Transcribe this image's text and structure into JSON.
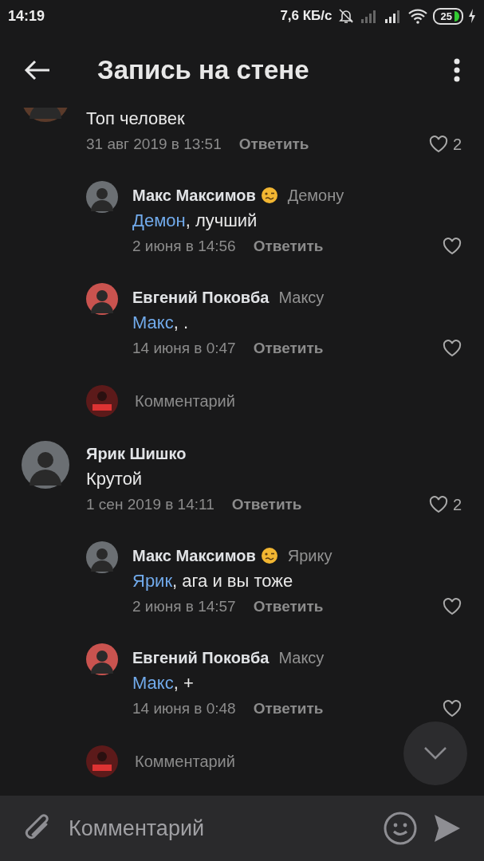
{
  "status_bar": {
    "time": "14:19",
    "speed": "7,6 КБ/с",
    "battery": "25"
  },
  "header": {
    "title": "Запись на стене"
  },
  "threads": [
    {
      "comment": {
        "text": "Топ человек",
        "date": "31 авг 2019 в 13:51",
        "reply": "Ответить",
        "likes": "2"
      },
      "replies": [
        {
          "author": "Макс Максимов",
          "emoji": true,
          "reply_to": "Демону",
          "mention": "Демон",
          "text": ", лучший",
          "date": "2 июня в 14:56",
          "reply": "Ответить"
        },
        {
          "author": "Евгений Поковба",
          "emoji": false,
          "reply_to": "Максу",
          "mention": "Макс",
          "text": ", .",
          "date": "14 июня в 0:47",
          "reply": "Ответить"
        }
      ],
      "composer": {
        "placeholder": "Комментарий"
      }
    },
    {
      "comment": {
        "author": "Ярик Шишко",
        "text": "Крутой",
        "date": "1 сен 2019 в 14:11",
        "reply": "Ответить",
        "likes": "2"
      },
      "replies": [
        {
          "author": "Макс Максимов",
          "emoji": true,
          "reply_to": "Ярику",
          "mention": "Ярик",
          "text": ", ага и вы тоже",
          "date": "2 июня в 14:57",
          "reply": "Ответить"
        },
        {
          "author": "Евгений Поковба",
          "emoji": false,
          "reply_to": "Максу",
          "mention": "Макс",
          "text": ", +",
          "date": "14 июня в 0:48",
          "reply": "Ответить"
        }
      ],
      "composer": {
        "placeholder": "Комментарий"
      }
    }
  ],
  "input": {
    "placeholder": "Комментарий"
  }
}
